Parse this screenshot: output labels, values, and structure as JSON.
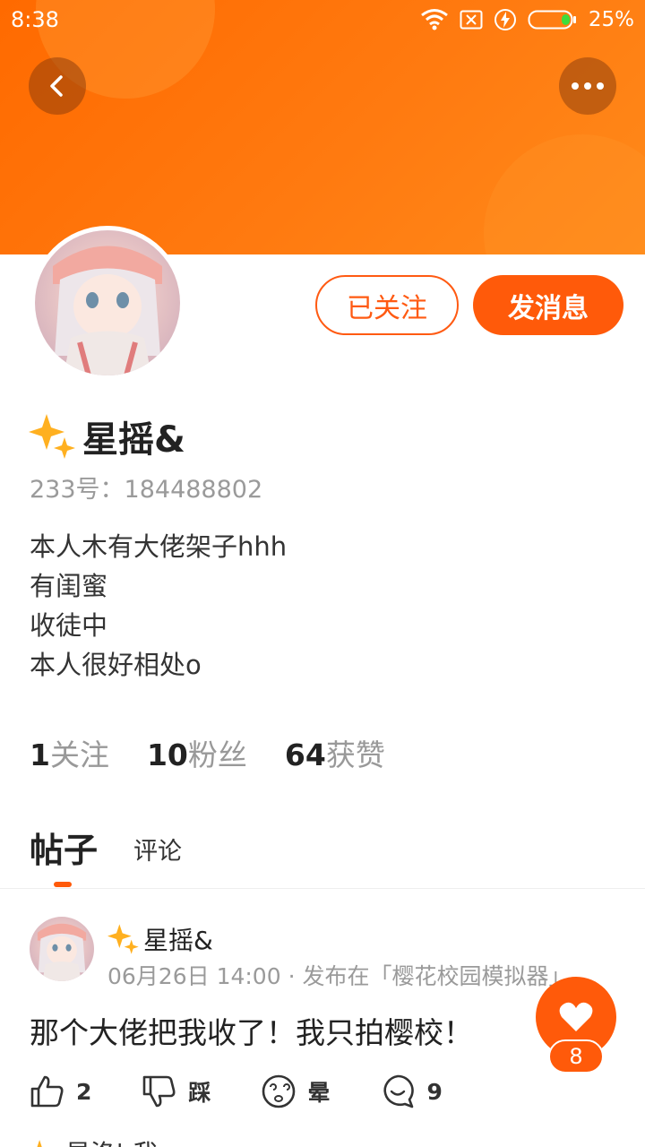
{
  "status_bar": {
    "time": "8:38",
    "battery": "25%"
  },
  "profile": {
    "username": "星摇&",
    "uid_line": "233号：184488802",
    "bio": [
      "本人木有大佬架子hhh",
      "有闺蜜",
      "收徒中",
      "本人很好相处o"
    ],
    "follow_button": "已关注",
    "message_button": "发消息",
    "stats": [
      {
        "num": "1",
        "label": "关注"
      },
      {
        "num": "10",
        "label": "粉丝"
      },
      {
        "num": "64",
        "label": "获赞"
      }
    ]
  },
  "tabs": {
    "posts": "帖子",
    "comments": "评论"
  },
  "post": {
    "author": "星摇&",
    "meta": "06月26日 14:00 · 发布在「樱花校园模拟器」",
    "text": "那个大佬把我收了！我只拍樱校！",
    "actions": {
      "like": "2",
      "dislike": "踩",
      "dizzy": "晕",
      "comments": "9"
    }
  },
  "next_post": {
    "author": "星洛|",
    "text": "我"
  },
  "fab": {
    "count": "8"
  },
  "colors": {
    "accent": "#ff5a0a",
    "header": "#ff6a00"
  }
}
